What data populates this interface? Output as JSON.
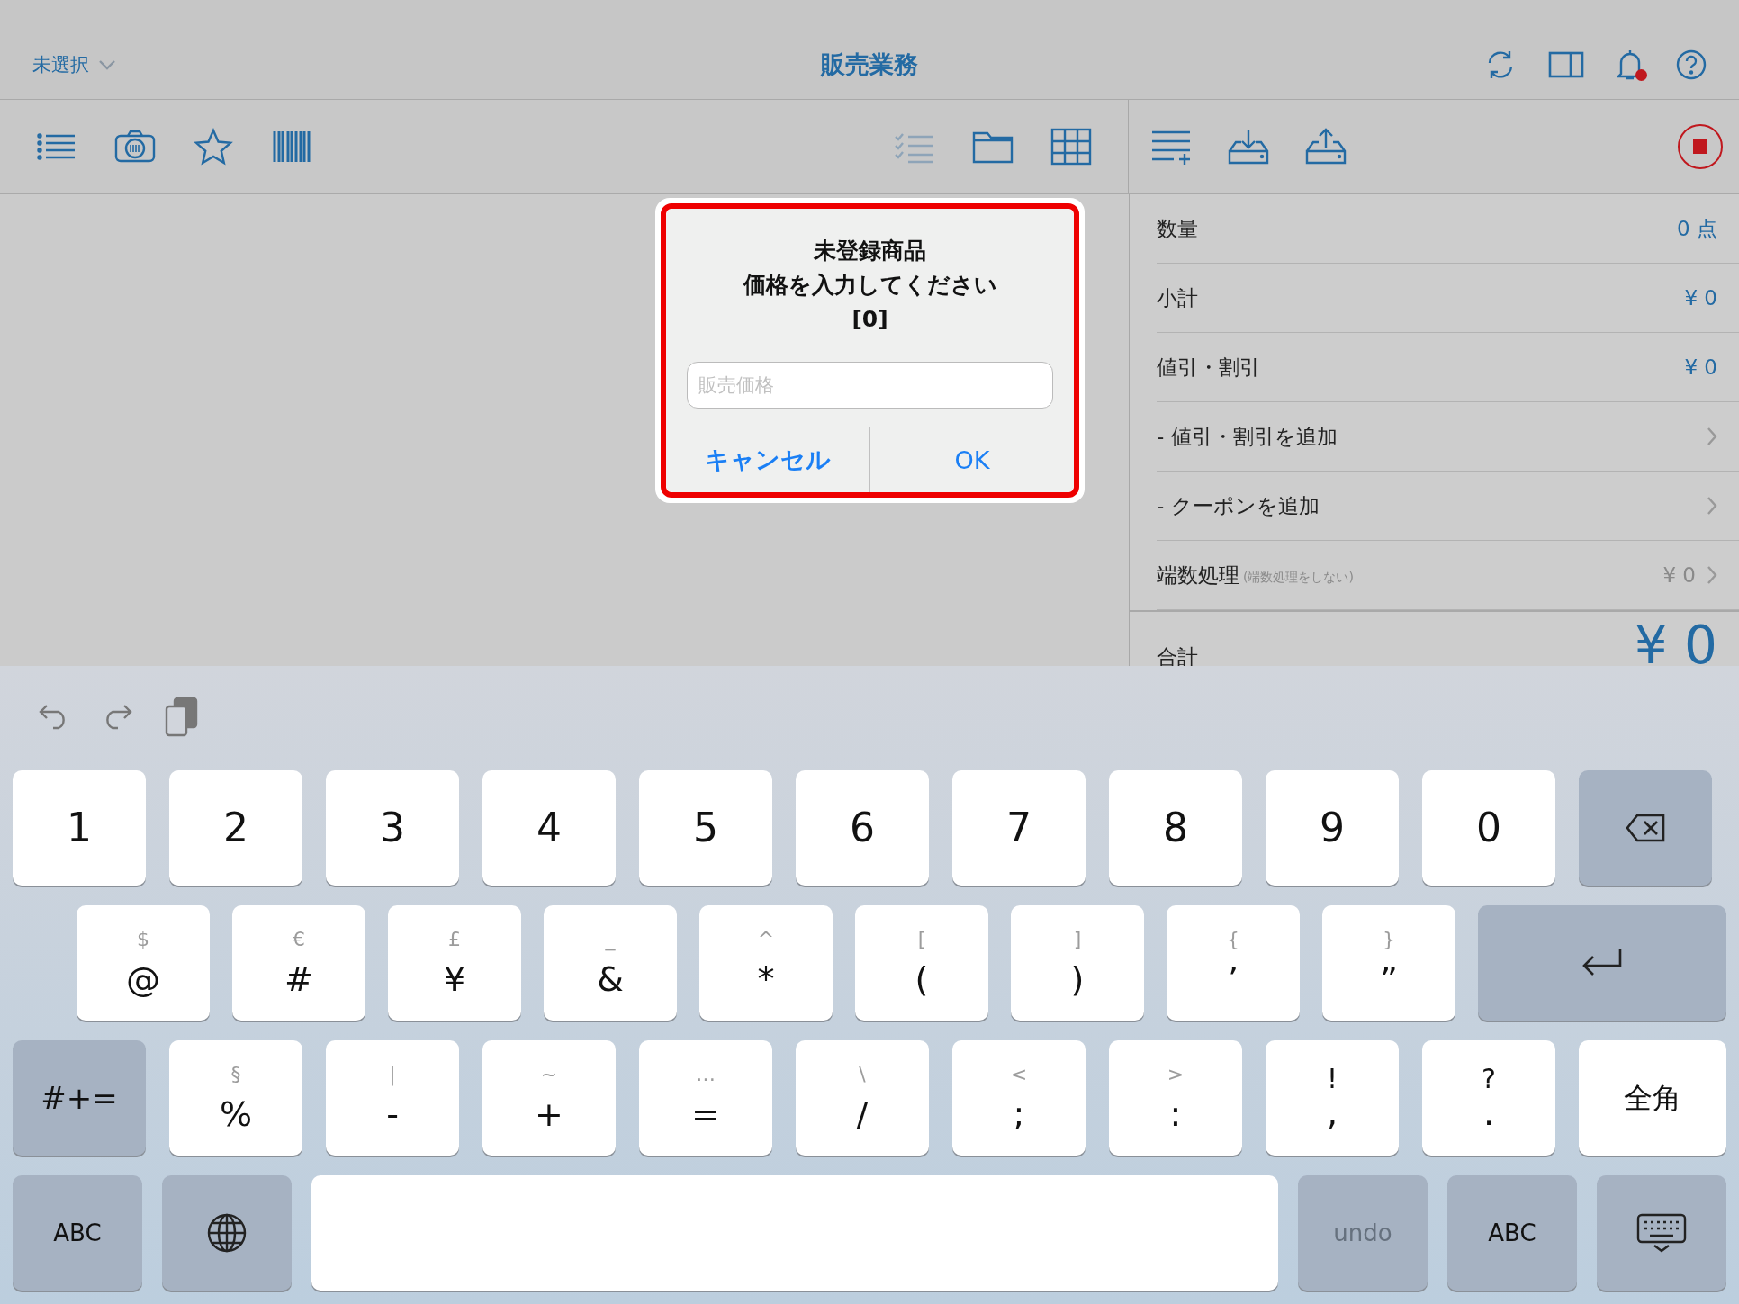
{
  "top_bar": {
    "selector": "未選択",
    "title": "販売業務",
    "notification_badge": true
  },
  "toolbar": {
    "left": [
      {
        "kind": "list",
        "disabled": false
      },
      {
        "kind": "camera",
        "disabled": false
      },
      {
        "kind": "star",
        "disabled": false
      },
      {
        "kind": "barcode",
        "disabled": false
      }
    ],
    "middle": [
      {
        "kind": "checklist",
        "disabled": true
      },
      {
        "kind": "folder",
        "disabled": false
      },
      {
        "kind": "grid",
        "disabled": false
      }
    ],
    "right": [
      {
        "kind": "list-add",
        "disabled": false
      },
      {
        "kind": "tray-in",
        "disabled": false
      },
      {
        "kind": "tray-out",
        "disabled": false
      }
    ],
    "recording": true
  },
  "summary": {
    "rows": [
      {
        "kind": "value",
        "label": "数量",
        "value": "0 点"
      },
      {
        "kind": "value",
        "label": "小計",
        "value": "¥ 0"
      },
      {
        "kind": "value",
        "label": "値引・割引",
        "value": "¥ 0"
      },
      {
        "kind": "link",
        "label": "- 値引・割引を追加"
      },
      {
        "kind": "link",
        "label": "- クーポンを追加"
      },
      {
        "kind": "rounding",
        "label": "端数処理",
        "note": "(端数処理をしない)",
        "value": "¥ 0"
      }
    ],
    "total": {
      "label": "合計",
      "value": "¥ 0"
    }
  },
  "dialog": {
    "highlighted": true,
    "lines": [
      "未登録商品",
      "価格を入力してください",
      "[0]"
    ],
    "field": {
      "placeholder": "販売価格"
    },
    "buttons": [
      {
        "label": "キャンセル",
        "kind": "cancel"
      },
      {
        "label": "OK",
        "kind": "default"
      }
    ]
  },
  "keyboard": {
    "rows": [
      [
        {
          "kind": "char",
          "main": "1"
        },
        {
          "kind": "char",
          "main": "2"
        },
        {
          "kind": "char",
          "main": "3"
        },
        {
          "kind": "char",
          "main": "4"
        },
        {
          "kind": "char",
          "main": "5"
        },
        {
          "kind": "char",
          "main": "6"
        },
        {
          "kind": "char",
          "main": "7"
        },
        {
          "kind": "char",
          "main": "8"
        },
        {
          "kind": "char",
          "main": "9"
        },
        {
          "kind": "char",
          "main": "0"
        },
        {
          "kind": "backspace"
        }
      ],
      [
        {
          "kind": "alt",
          "top": "$",
          "main": "@"
        },
        {
          "kind": "alt",
          "top": "€",
          "main": "#"
        },
        {
          "kind": "alt",
          "top": "£",
          "main": "¥"
        },
        {
          "kind": "alt",
          "top": "_",
          "main": "&"
        },
        {
          "kind": "alt",
          "top": "^",
          "main": "*"
        },
        {
          "kind": "alt",
          "top": "[",
          "main": "("
        },
        {
          "kind": "alt",
          "top": "]",
          "main": ")"
        },
        {
          "kind": "alt",
          "top": "{",
          "main": "’"
        },
        {
          "kind": "alt",
          "top": "}",
          "main": "”"
        },
        {
          "kind": "return"
        }
      ],
      [
        {
          "kind": "func",
          "main": "#+="
        },
        {
          "kind": "alt",
          "top": "§",
          "main": "%"
        },
        {
          "kind": "alt",
          "top": "|",
          "main": "-"
        },
        {
          "kind": "alt",
          "top": "~",
          "main": "+"
        },
        {
          "kind": "alt",
          "top": "…",
          "main": "="
        },
        {
          "kind": "alt",
          "top": "\\",
          "main": "/"
        },
        {
          "kind": "alt",
          "top": "<",
          "main": ";"
        },
        {
          "kind": "alt",
          "top": ">",
          "main": ":"
        },
        {
          "kind": "pair",
          "top": "!",
          "main": ","
        },
        {
          "kind": "pair",
          "top": "?",
          "main": "."
        },
        {
          "kind": "wide",
          "main": "全角"
        }
      ],
      [
        {
          "kind": "func",
          "main": "ABC",
          "disabled": false
        },
        {
          "kind": "globe"
        },
        {
          "kind": "space"
        },
        {
          "kind": "func",
          "main": "undo",
          "disabled": true
        },
        {
          "kind": "func",
          "main": "ABC",
          "disabled": false
        },
        {
          "kind": "hide"
        }
      ]
    ]
  }
}
